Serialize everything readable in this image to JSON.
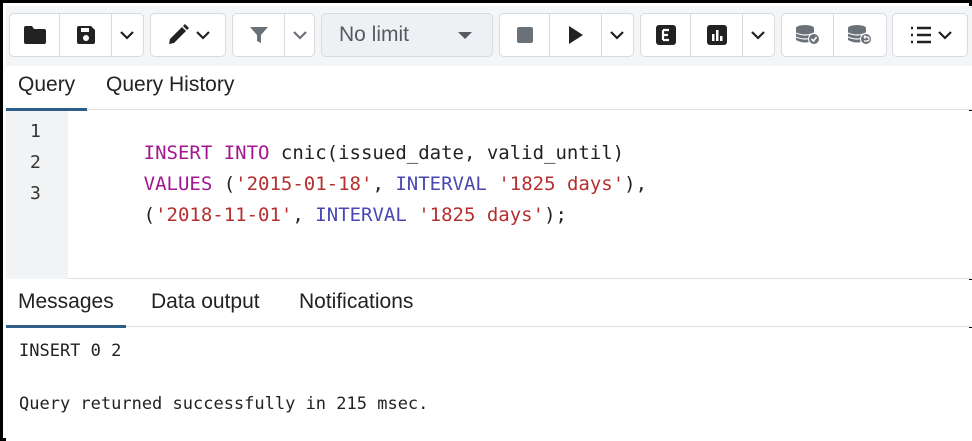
{
  "toolbar": {
    "buttons": [
      {
        "name": "open-file",
        "icon": "folder-icon"
      },
      {
        "name": "save-file",
        "icon": "save-icon"
      },
      {
        "name": "edit",
        "icon": "pencil-icon"
      },
      {
        "name": "filter",
        "icon": "filter-icon"
      },
      {
        "name": "stop",
        "icon": "stop-icon"
      },
      {
        "name": "execute",
        "icon": "play-icon"
      },
      {
        "name": "explain",
        "icon": "explain-icon",
        "label": "E"
      },
      {
        "name": "explain-analyze",
        "icon": "bar-chart-icon"
      },
      {
        "name": "commit",
        "icon": "database-check-icon"
      },
      {
        "name": "rollback",
        "icon": "database-undo-icon"
      },
      {
        "name": "macros",
        "icon": "list-icon"
      }
    ],
    "limit": {
      "value": "No limit"
    }
  },
  "query_tabs": [
    "Query",
    "Query History"
  ],
  "active_query_tab": "Query",
  "editor": {
    "line_numbers": [
      "1",
      "2",
      "3"
    ],
    "lines": [
      [
        {
          "t": "INSERT INTO",
          "c": "kw"
        },
        {
          "t": " cnic(issued_date, valid_until)",
          "c": ""
        }
      ],
      [
        {
          "t": "VALUES",
          "c": "kw"
        },
        {
          "t": " (",
          "c": ""
        },
        {
          "t": "'2015-01-18'",
          "c": "str"
        },
        {
          "t": ", ",
          "c": ""
        },
        {
          "t": "INTERVAL",
          "c": "fn"
        },
        {
          "t": " ",
          "c": ""
        },
        {
          "t": "'1825 days'",
          "c": "str"
        },
        {
          "t": "),",
          "c": ""
        }
      ],
      [
        {
          "t": "(",
          "c": ""
        },
        {
          "t": "'2018-11-01'",
          "c": "str"
        },
        {
          "t": ", ",
          "c": ""
        },
        {
          "t": "INTERVAL",
          "c": "fn"
        },
        {
          "t": " ",
          "c": ""
        },
        {
          "t": "'1825 days'",
          "c": "str"
        },
        {
          "t": ");",
          "c": ""
        }
      ]
    ]
  },
  "result_tabs": [
    "Messages",
    "Data output",
    "Notifications"
  ],
  "active_result_tab": "Messages",
  "messages": [
    "INSERT 0 2",
    "Query returned successfully in 215 msec."
  ],
  "colors": {
    "keyword": "#a3168f",
    "string": "#b52f2f",
    "function": "#4848b0",
    "active_tab_underline": "#2e5d86"
  }
}
